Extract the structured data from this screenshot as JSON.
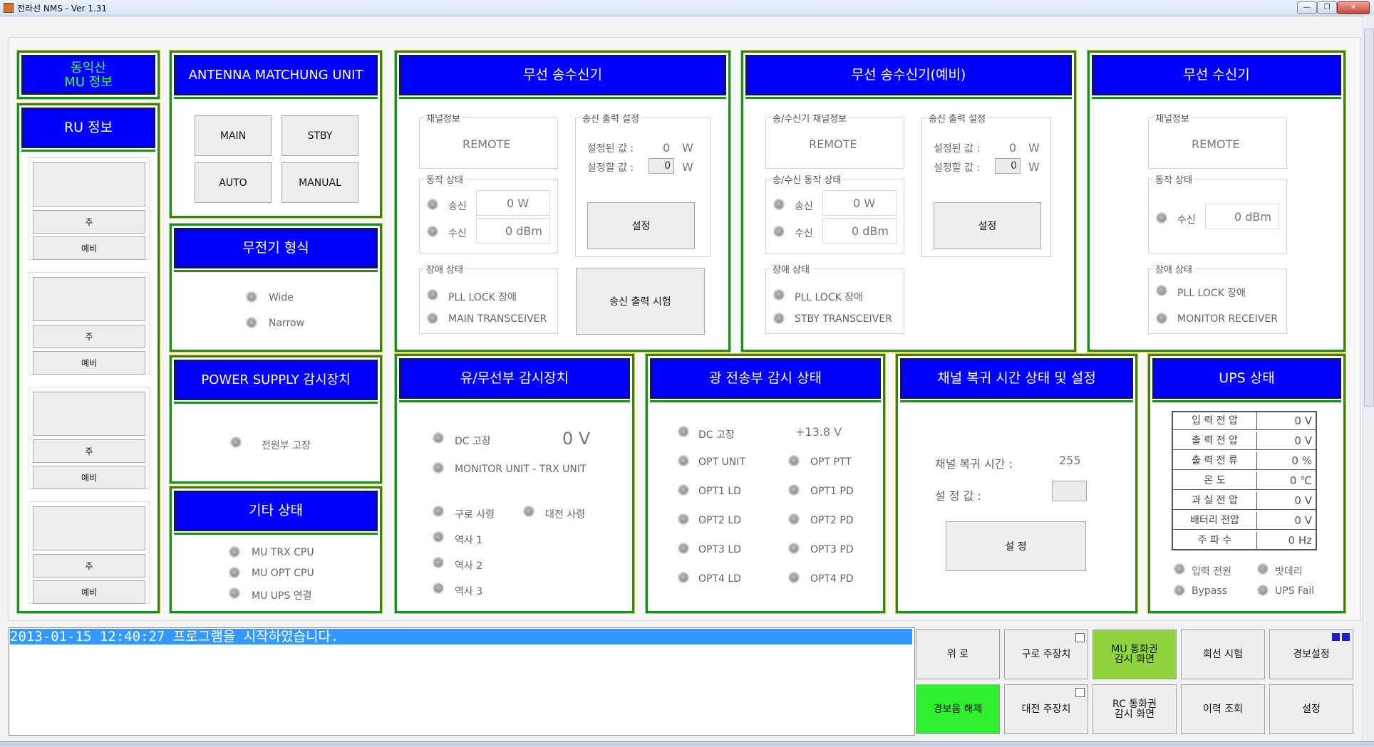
{
  "window": {
    "title": "전라선 NMS  - Ver 1.31"
  },
  "left": {
    "header": "동익산\nMU 정보",
    "ru_title": "RU 정보",
    "ru_items": [
      {
        "main": "주",
        "spare": "예비"
      },
      {
        "main": "주",
        "spare": "예비"
      },
      {
        "main": "주",
        "spare": "예비"
      },
      {
        "main": "주",
        "spare": "예비"
      }
    ]
  },
  "antenna": {
    "title": "ANTENNA MATCHUNG UNIT",
    "main": "MAIN",
    "stby": "STBY",
    "auto": "AUTO",
    "manual": "MANUAL"
  },
  "radio_type": {
    "title": "무전기 형식",
    "wide": "Wide",
    "narrow": "Narrow"
  },
  "power_supply": {
    "title": "POWER SUPPLY 감시장치",
    "fault": "전원부 고장"
  },
  "other": {
    "title": "기타 상태",
    "items": [
      "MU TRX CPU",
      "MU OPT CPU",
      "MU UPS 연결"
    ]
  },
  "tx1": {
    "title": "무선 송수신기",
    "channel_group": "채널정보",
    "channel_value": "REMOTE",
    "op_group": "동작 상태",
    "tx_label": "송신",
    "tx_value": "0  W",
    "rx_label": "수신",
    "rx_value": "0 dBm",
    "fault_group": "장애 상태",
    "fault1": "PLL LOCK 장애",
    "fault2": "MAIN TRANSCEIVER",
    "out_group": "송신 출력 설정",
    "set_label": "설정된 값 :",
    "set_value": "0",
    "set_unit": "W",
    "target_label": "설정할 값 :",
    "target_value": "0",
    "target_unit": "W",
    "set_button": "설정",
    "test_button": "송신 출력 시험"
  },
  "tx2": {
    "title": "무선 송수신기(예비)",
    "channel_group": "송/수신기 채널정보",
    "channel_value": "REMOTE",
    "op_group": "송/수신 동작 상태",
    "tx_label": "송신",
    "tx_value": "0  W",
    "rx_label": "수신",
    "rx_value": "0 dBm",
    "fault_group": "장애 상태",
    "fault1": "PLL LOCK 장애",
    "fault2": "STBY TRANSCEIVER",
    "out_group": "송신 출력 설정",
    "set_label": "설정된 값 :",
    "set_value": "0",
    "set_unit": "W",
    "target_label": "설정할 값 :",
    "target_value": "0",
    "target_unit": "W",
    "set_button": "설정"
  },
  "rx": {
    "title": "무선 수신기",
    "channel_group": "채널정보",
    "channel_value": "REMOTE",
    "op_group": "동작 상태",
    "rx_label": "수신",
    "rx_value": "0 dBm",
    "fault_group": "장애 상태",
    "fault1": "PLL LOCK 장애",
    "fault2": "MONITOR RECEIVER"
  },
  "wired": {
    "title": "유/무선부 감시장치",
    "dc": "DC 고장",
    "dc_value": "0 V",
    "monitor": "MONITOR UNIT - TRX UNIT",
    "guro": "구로 사령",
    "daejeon": "대전 사령",
    "st1": "역사 1",
    "st2": "역사 2",
    "st3": "역사 3"
  },
  "optical": {
    "title": "광 전송부 감시 상태",
    "dc": "DC 고장",
    "dc_value": "+13.8  V",
    "left": [
      "OPT UNIT",
      "OPT1 LD",
      "OPT2 LD",
      "OPT3 LD",
      "OPT4 LD"
    ],
    "right": [
      "OPT PTT",
      "OPT1 PD",
      "OPT2 PD",
      "OPT3 PD",
      "OPT4 PD"
    ]
  },
  "recovery": {
    "title": "채널 복귀 시간 상태 및 설정",
    "time_label": "채널 복귀 시간 :",
    "time_value": "255",
    "set_label": "설 정 값 :",
    "button": "설 정"
  },
  "ups": {
    "title": "UPS 상태",
    "rows": [
      {
        "k": "입 력 전 압",
        "v": "0 V"
      },
      {
        "k": "출 력 전 압",
        "v": "0 V"
      },
      {
        "k": "출 력 전 류",
        "v": "0 %"
      },
      {
        "k": "온    도",
        "v": "0 ℃"
      },
      {
        "k": "과 실 전 압",
        "v": "0 V"
      },
      {
        "k": "배터리 전압",
        "v": "0 V"
      },
      {
        "k": "주 파 수",
        "v": "0 Hz"
      }
    ],
    "input_power": "입력 전원",
    "battery": "밧데리",
    "bypass": "Bypass",
    "ups_fail": "UPS Fail"
  },
  "log": {
    "line": "2013-01-15 12:40:27 프로그램을 시작하였습니다."
  },
  "buttons": {
    "wiro": "위 로",
    "guro_main": "구로 주장치",
    "mu_call": "MU 통화권\n감시 화면",
    "line_test": "회선 시험",
    "alarm_set": "경보설정",
    "alarm_release": "경보음 해제",
    "daejeon_main": "대전 주장치",
    "rc_call": "RC 통화권\n감시 화면",
    "history": "이력 조회",
    "settings": "설정"
  },
  "colors": {
    "header_blue": "#0000ff",
    "panel_border": "#1e8c1e",
    "green_button": "#8fd43c",
    "lime_button": "#2ef02e",
    "log_highlight": "#3399ff"
  }
}
